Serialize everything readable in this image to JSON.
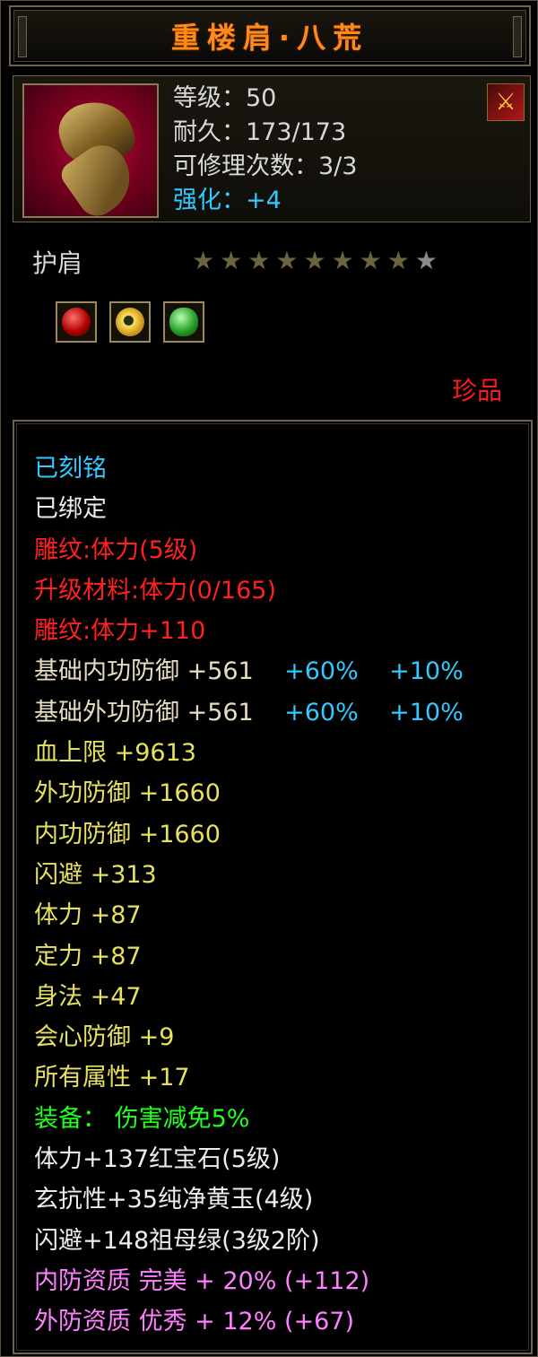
{
  "item": {
    "name": "重楼肩·八荒",
    "level_line": "等级：50",
    "durability_line": "耐久：173/173",
    "repair_line": "可修理次数：3/3",
    "enhance_line": "强化：+4",
    "type": "护肩",
    "star_count": 9,
    "rarity": "珍品"
  },
  "gems": [
    {
      "icon": "ruby-gem-icon"
    },
    {
      "icon": "yellow-jade-gem-icon"
    },
    {
      "icon": "emerald-gem-icon"
    }
  ],
  "attributes": {
    "engraved": "已刻铭",
    "bound": "已绑定",
    "carving": "雕纹:体力(5级)",
    "upgrade_material": "升级材料:体力(0/165)",
    "carving_bonus": "雕纹:体力+110",
    "base_inner_def": {
      "label": "基础内功防御  +561",
      "pct1": "+60%",
      "pct2": "+10%"
    },
    "base_outer_def": {
      "label": "基础外功防御  +561",
      "pct1": "+60%",
      "pct2": "+10%"
    },
    "stats": [
      "血上限  +9613",
      "外功防御  +1660",
      "内功防御  +1660",
      "闪避  +313",
      "体力  +87",
      "定力  +87",
      "身法  +47",
      "会心防御  +9",
      "所有属性  +17"
    ],
    "equip_bonus": "装备：  伤害减免5%",
    "gem_lines": [
      "体力+137红宝石(5级)",
      "玄抗性+35纯净黄玉(4级)",
      "闪避+148祖母绿(3级2阶)"
    ],
    "quality_lines": [
      "内防资质  完美  +  20%  (+112)",
      "外防资质  优秀  +  12%  (+67)"
    ]
  },
  "colors": {
    "title": "#ff8a1a",
    "enhance": "#33c8ff",
    "rarity": "#ff1a1a",
    "carving": "#ff2020",
    "stats": "#e8e060",
    "equip": "#20ff20",
    "quality": "#ff80ff"
  }
}
